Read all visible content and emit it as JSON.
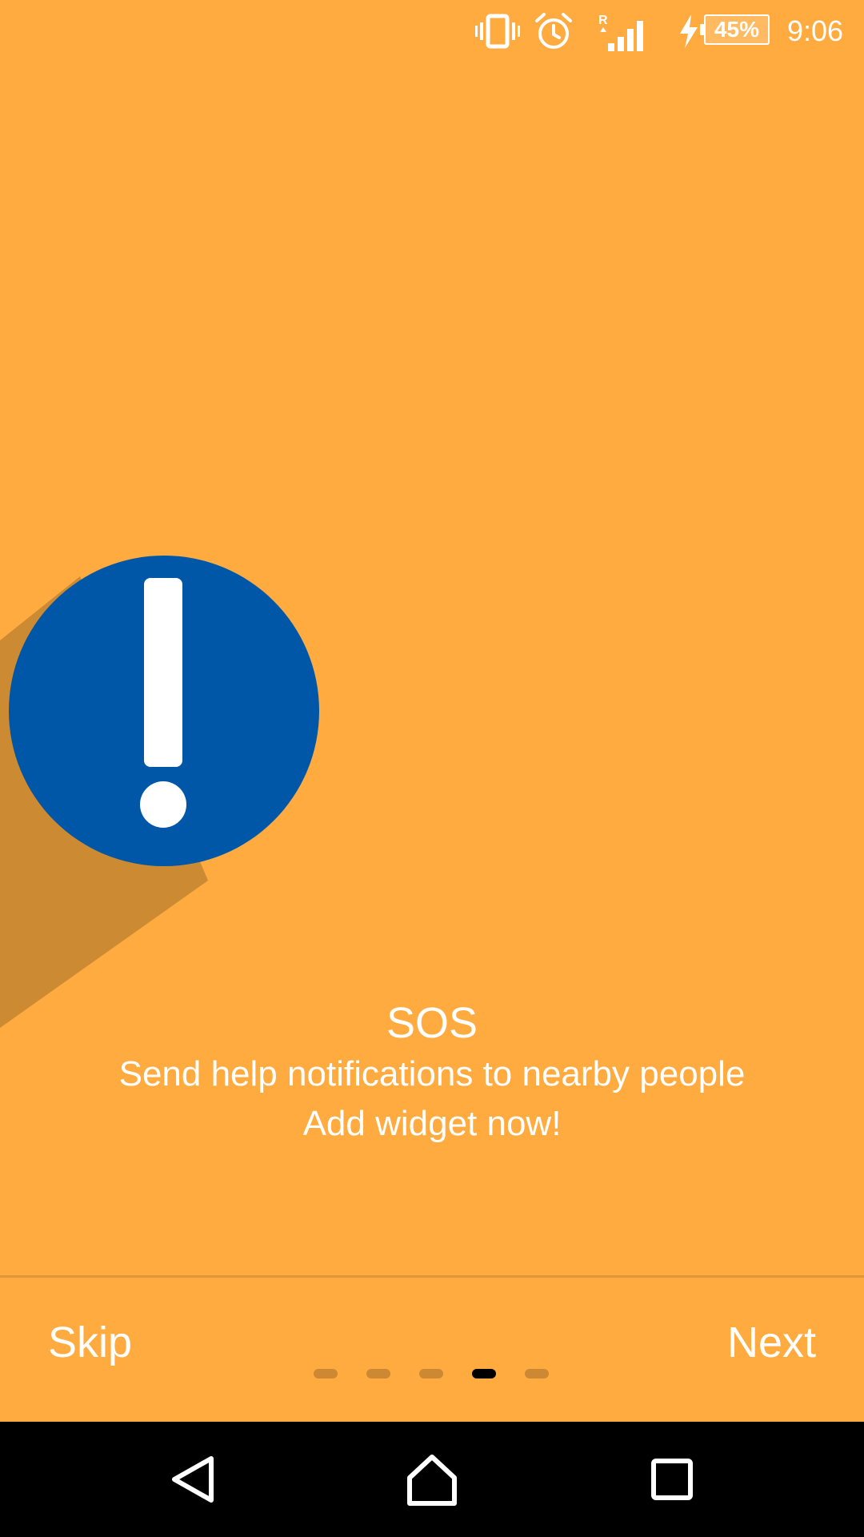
{
  "status_bar": {
    "battery_percent": "45%",
    "time": "9:06",
    "icons": [
      "vibrate-icon",
      "alarm-icon",
      "roaming-signal-icon",
      "charging-icon",
      "battery-icon"
    ]
  },
  "slide": {
    "title": "SOS",
    "description": "Send help notifications to nearby people",
    "call_to_action": "Add widget now!",
    "illustration_icon": "alert-exclamation-icon",
    "colors": {
      "background": "#FFAB40",
      "shadow": "#CC8A33",
      "circle": "#0057A8",
      "mark": "#FFFFFF"
    }
  },
  "controls": {
    "skip_label": "Skip",
    "next_label": "Next",
    "page_count": 5,
    "current_page": 4
  },
  "nav_bar": {
    "icons": [
      "back-icon",
      "home-icon",
      "recents-icon"
    ]
  }
}
